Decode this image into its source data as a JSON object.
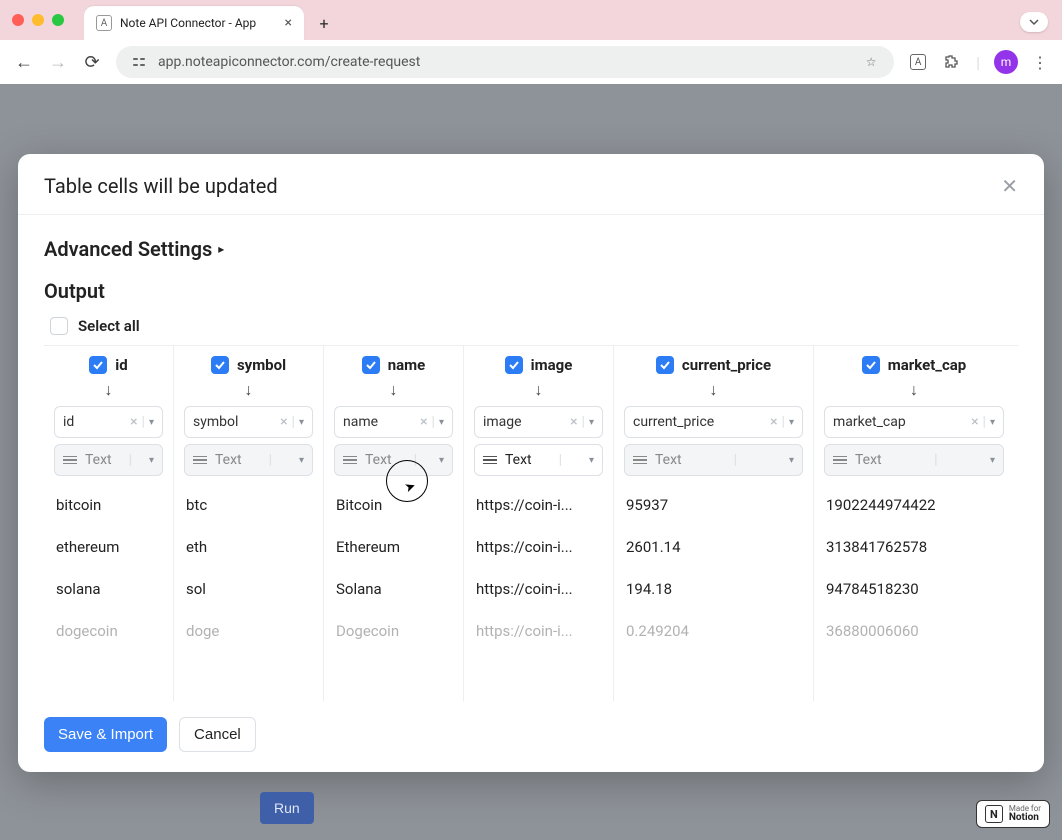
{
  "browser": {
    "tab_title": "Note API Connector - App",
    "url": "app.noteapiconnector.com/create-request",
    "avatar_letter": "m"
  },
  "modal": {
    "title": "Table cells will be updated",
    "advanced_label": "Advanced Settings",
    "output_label": "Output",
    "select_all_label": "Select all",
    "save_label": "Save & Import",
    "cancel_label": "Cancel"
  },
  "columns": [
    {
      "key": "id",
      "map_value": "id",
      "type_label": "Text",
      "type_enabled": false
    },
    {
      "key": "symbol",
      "map_value": "symbol",
      "type_label": "Text",
      "type_enabled": false
    },
    {
      "key": "name",
      "map_value": "name",
      "type_label": "Text",
      "type_enabled": false
    },
    {
      "key": "image",
      "map_value": "image",
      "type_label": "Text",
      "type_enabled": true
    },
    {
      "key": "current_price",
      "map_value": "current_price",
      "type_label": "Text",
      "type_enabled": false
    },
    {
      "key": "market_cap",
      "map_value": "market_cap",
      "type_label": "Text",
      "type_enabled": false
    }
  ],
  "rows": [
    {
      "id": "bitcoin",
      "symbol": "btc",
      "name": "Bitcoin",
      "image": "https://coin-i...",
      "current_price": "95937",
      "market_cap": "1902244974422"
    },
    {
      "id": "ethereum",
      "symbol": "eth",
      "name": "Ethereum",
      "image": "https://coin-i...",
      "current_price": "2601.14",
      "market_cap": "313841762578"
    },
    {
      "id": "solana",
      "symbol": "sol",
      "name": "Solana",
      "image": "https://coin-i...",
      "current_price": "194.18",
      "market_cap": "94784518230"
    },
    {
      "id": "dogecoin",
      "symbol": "doge",
      "name": "Dogecoin",
      "image": "https://coin-i...",
      "current_price": "0.249204",
      "market_cap": "36880006060"
    }
  ],
  "run_label": "Run",
  "notion_badge": {
    "small": "Made for",
    "brand": "Notion"
  }
}
